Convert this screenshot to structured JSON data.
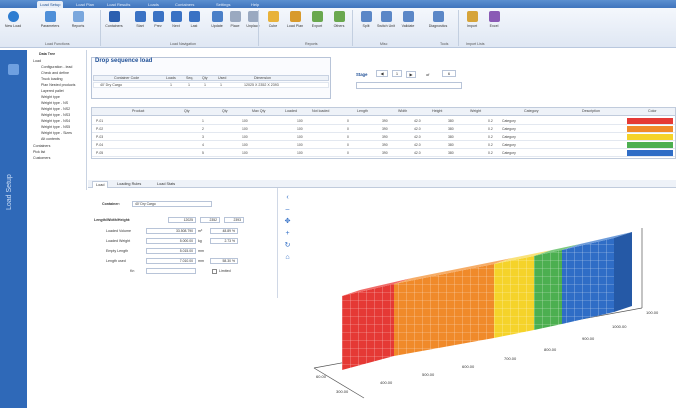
{
  "menu": {
    "tabs": [
      "",
      "Load Setup",
      "Load Plan",
      "Load Results",
      "Loads",
      "Containers",
      "Settings",
      "Help"
    ]
  },
  "ribbon": {
    "buttons": [
      {
        "label": "New Load",
        "color": "#2e7dd1"
      },
      {
        "label": "Parameters",
        "color": "#4f8fd8"
      },
      {
        "label": "Reports",
        "color": "#7aa7dd"
      },
      {
        "label": "Containers",
        "color": "#2b5fb0"
      },
      {
        "label": "Start",
        "color": "#3a72c4"
      },
      {
        "label": "Prev",
        "color": "#3a72c4"
      },
      {
        "label": "Next",
        "color": "#3a72c4"
      },
      {
        "label": "Last",
        "color": "#3a72c4"
      },
      {
        "label": "Update",
        "color": "#4b80c8"
      },
      {
        "label": "Place",
        "color": "#9aa9c0"
      },
      {
        "label": "Unplace",
        "color": "#9aa9c0"
      },
      {
        "label": "Cube",
        "color": "#e8b23a"
      },
      {
        "label": "Load Plan",
        "color": "#d89a2c"
      },
      {
        "label": "Export",
        "color": "#6aa84f"
      },
      {
        "label": "Others",
        "color": "#6aa84f"
      },
      {
        "label": "Split",
        "color": "#5b87c7"
      },
      {
        "label": "Switch Unit",
        "color": "#5b87c7"
      },
      {
        "label": "Validate",
        "color": "#5b87c7"
      },
      {
        "label": "Diagnostics",
        "color": "#5b87c7"
      },
      {
        "label": "Import",
        "color": "#d6a43a"
      },
      {
        "label": "Excel",
        "color": "#8a5ab5"
      }
    ],
    "groups": [
      "Load Functions",
      "Load Navigation",
      "Reports",
      "Misc",
      "Tools",
      "Import Lists"
    ]
  },
  "tree": {
    "items": [
      "Data Tree",
      "Load",
      "Configuration - lead",
      "Check and define",
      "Truck loading",
      "Plan Nested products",
      "Layered pallet",
      "Weight type",
      "Weight type - NS",
      "Weight type - NS2",
      "Weight type - NS3",
      "Weight type - NS4",
      "Weight type - NS5",
      "Weight type - Sizes",
      "Alt contents",
      "Containers",
      "Pick list",
      "Customers"
    ]
  },
  "sequence": {
    "title": "Drop sequence load",
    "headers": [
      "Container Code",
      "Loads",
      "Seq.",
      "Qty",
      "Used",
      "Dimension"
    ],
    "row": [
      "40' Dry Cargo",
      "1",
      "1",
      "1",
      "1",
      "12025 X 2352 X 2393"
    ]
  },
  "stage": {
    "label": "Stage",
    "value": "1",
    "of_label": "of",
    "total": "6"
  },
  "grid": {
    "headers": [
      "Product",
      "Qty",
      "Qty",
      "Max Qty",
      "Loaded",
      "Not loaded",
      "Length",
      "Width",
      "Height",
      "Weight",
      "Category",
      "Description",
      "Color"
    ],
    "rows": [
      {
        "cells": [
          "P-01",
          "1",
          "100",
          "",
          "100",
          "0",
          "390",
          "42.0",
          "380",
          "0.2",
          "Category",
          ""
        ],
        "color": "#e53935"
      },
      {
        "cells": [
          "P-02",
          "2",
          "100",
          "",
          "100",
          "0",
          "390",
          "42.0",
          "380",
          "0.2",
          "Category",
          ""
        ],
        "color": "#f08a2a"
      },
      {
        "cells": [
          "P-03",
          "3",
          "100",
          "",
          "100",
          "0",
          "390",
          "42.0",
          "380",
          "0.2",
          "Category",
          ""
        ],
        "color": "#f5d32a"
      },
      {
        "cells": [
          "P-04",
          "4",
          "100",
          "",
          "100",
          "0",
          "390",
          "42.0",
          "380",
          "0.2",
          "Category",
          ""
        ],
        "color": "#4caf50"
      },
      {
        "cells": [
          "P-05",
          "5",
          "100",
          "",
          "100",
          "0",
          "390",
          "42.0",
          "380",
          "0.2",
          "Category",
          ""
        ],
        "color": "#2f6dc6"
      }
    ]
  },
  "lower_tabs": [
    "Load",
    "Loading Rules",
    "Load Stats"
  ],
  "props": {
    "container_label": "Container:",
    "container_value": "40' Dry Cargo",
    "dims_label": "Length/Width/Height:",
    "dims": [
      "12025",
      "2352",
      "2393"
    ],
    "rows": [
      {
        "label": "Loaded Volume",
        "value": "33.508.790",
        "unit": "m³",
        "pct": "48.89 %"
      },
      {
        "label": "Loaded Weight",
        "value": "5.000.00",
        "unit": "kg",
        "pct": "2.73 %"
      },
      {
        "label": "Empty Length",
        "value": "5.015.00",
        "unit": "mm",
        "pct": ""
      },
      {
        "label": "Length used",
        "value": "7.010.00",
        "unit": "mm",
        "pct": "58.30 %"
      },
      {
        "label": "Kn",
        "value": "",
        "unit": "",
        "pct": ""
      }
    ],
    "checkbox_label": "Limited"
  },
  "viewer": {
    "axis_labels": [
      "300.00",
      "400.00",
      "500.00",
      "600.00",
      "700.00",
      "800.00",
      "900.00",
      "1000.00",
      "100.00",
      "60.00"
    ]
  },
  "side_label": "Load Setup"
}
